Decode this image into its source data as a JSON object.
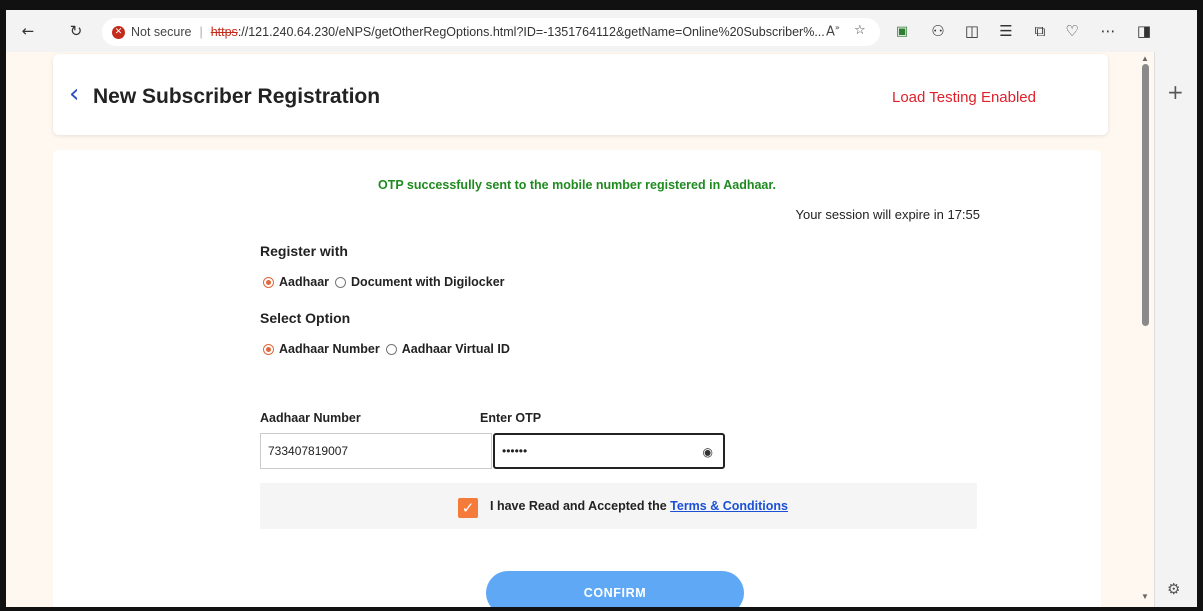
{
  "browser": {
    "security_label": "Not secure",
    "url_protocol": "https",
    "url_rest": "://121.240.64.230/eNPS/getOtherRegOptions.html?ID=-1351764112&getName=Online%20Subscriber%..."
  },
  "header": {
    "title": "New Subscriber Registration",
    "load_testing": "Load Testing Enabled"
  },
  "main": {
    "otp_message": "OTP successfully sent to the mobile number registered in Aadhaar.",
    "session_text": "Your session will expire in 17:55",
    "register_with": {
      "label": "Register with",
      "options": [
        "Aadhaar",
        "Document with Digilocker"
      ],
      "selected": "Aadhaar"
    },
    "select_option": {
      "label": "Select Option",
      "options": [
        "Aadhaar Number",
        "Aadhaar Virtual ID"
      ],
      "selected": "Aadhaar Number"
    },
    "aadhaar_field": {
      "label": "Aadhaar Number",
      "value": "733407819007"
    },
    "otp_field": {
      "label": "Enter OTP",
      "value": "••••••"
    },
    "terms": {
      "checked": true,
      "text": "I have Read and Accepted the ",
      "link": "Terms & Conditions"
    },
    "confirm_label": "CONFIRM"
  },
  "colors": {
    "accent": "#f47b3a",
    "success": "#1f8a1f",
    "alert": "#e0212a",
    "button": "#5fa8f5",
    "link": "#1a4fd6"
  }
}
